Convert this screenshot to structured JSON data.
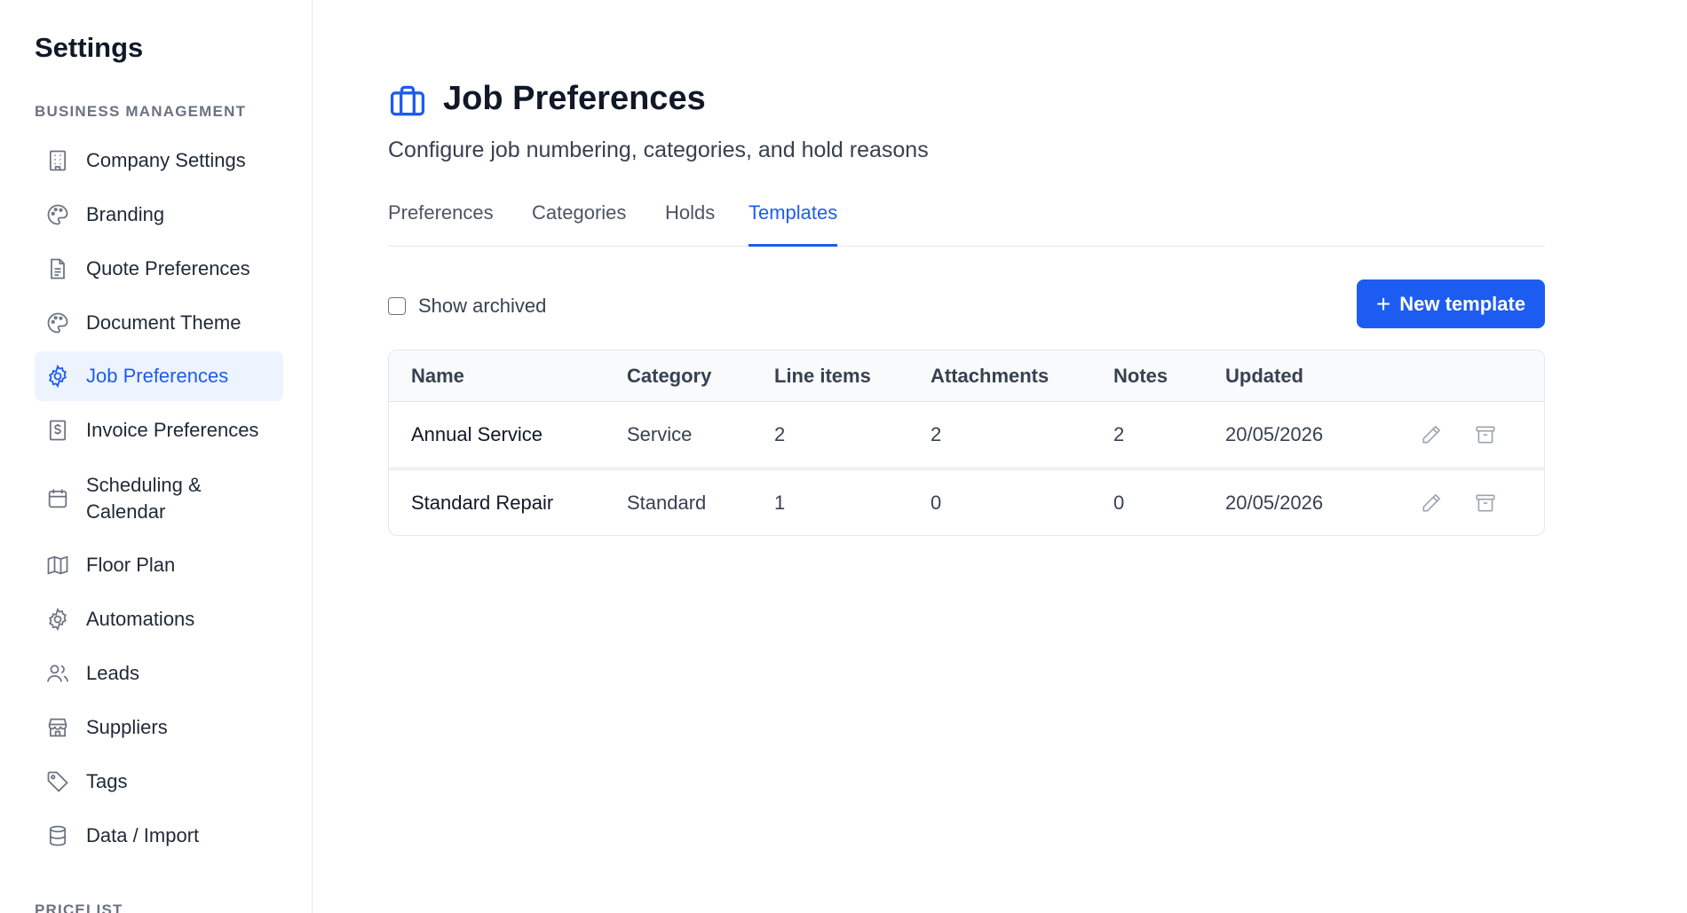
{
  "sidebar": {
    "title": "Settings",
    "section": "BUSINESS MANAGEMENT",
    "section_2": "PRICELIST",
    "items": [
      {
        "label": "Company Settings",
        "icon": "building-icon"
      },
      {
        "label": "Branding",
        "icon": "palette-icon"
      },
      {
        "label": "Quote Preferences",
        "icon": "document-icon"
      },
      {
        "label": "Document Theme",
        "icon": "palette-icon"
      },
      {
        "label": "Job Preferences",
        "icon": "gear-icon",
        "active": true
      },
      {
        "label": "Invoice Preferences",
        "icon": "dollar-doc-icon"
      },
      {
        "label": "Scheduling & Calendar",
        "icon": "calendar-icon"
      },
      {
        "label": "Floor Plan",
        "icon": "map-icon"
      },
      {
        "label": "Automations",
        "icon": "gear-icon"
      },
      {
        "label": "Leads",
        "icon": "users-icon"
      },
      {
        "label": "Suppliers",
        "icon": "store-icon"
      },
      {
        "label": "Tags",
        "icon": "tag-icon"
      },
      {
        "label": "Data / Import",
        "icon": "database-icon"
      }
    ]
  },
  "header": {
    "title": "Job Preferences",
    "subtitle": "Configure job numbering, categories, and hold reasons",
    "icon": "briefcase-icon"
  },
  "tabs": [
    {
      "label": "Preferences"
    },
    {
      "label": "Categories"
    },
    {
      "label": "Holds"
    },
    {
      "label": "Templates",
      "active": true
    }
  ],
  "toolbar": {
    "show_archived_label": "Show archived",
    "show_archived_checked": false,
    "new_button_label": "New template"
  },
  "table": {
    "columns": [
      "Name",
      "Category",
      "Line items",
      "Attachments",
      "Notes",
      "Updated"
    ],
    "rows": [
      {
        "name": "Annual Service",
        "category": "Service",
        "line_items": "2",
        "attachments": "2",
        "notes": "2",
        "updated": "20/05/2026"
      },
      {
        "name": "Standard Repair",
        "category": "Standard",
        "line_items": "1",
        "attachments": "0",
        "notes": "0",
        "updated": "20/05/2026"
      }
    ]
  },
  "colors": {
    "accent": "#1d5cf0",
    "active_bg": "#eef4ff",
    "border": "#e5e7eb"
  }
}
